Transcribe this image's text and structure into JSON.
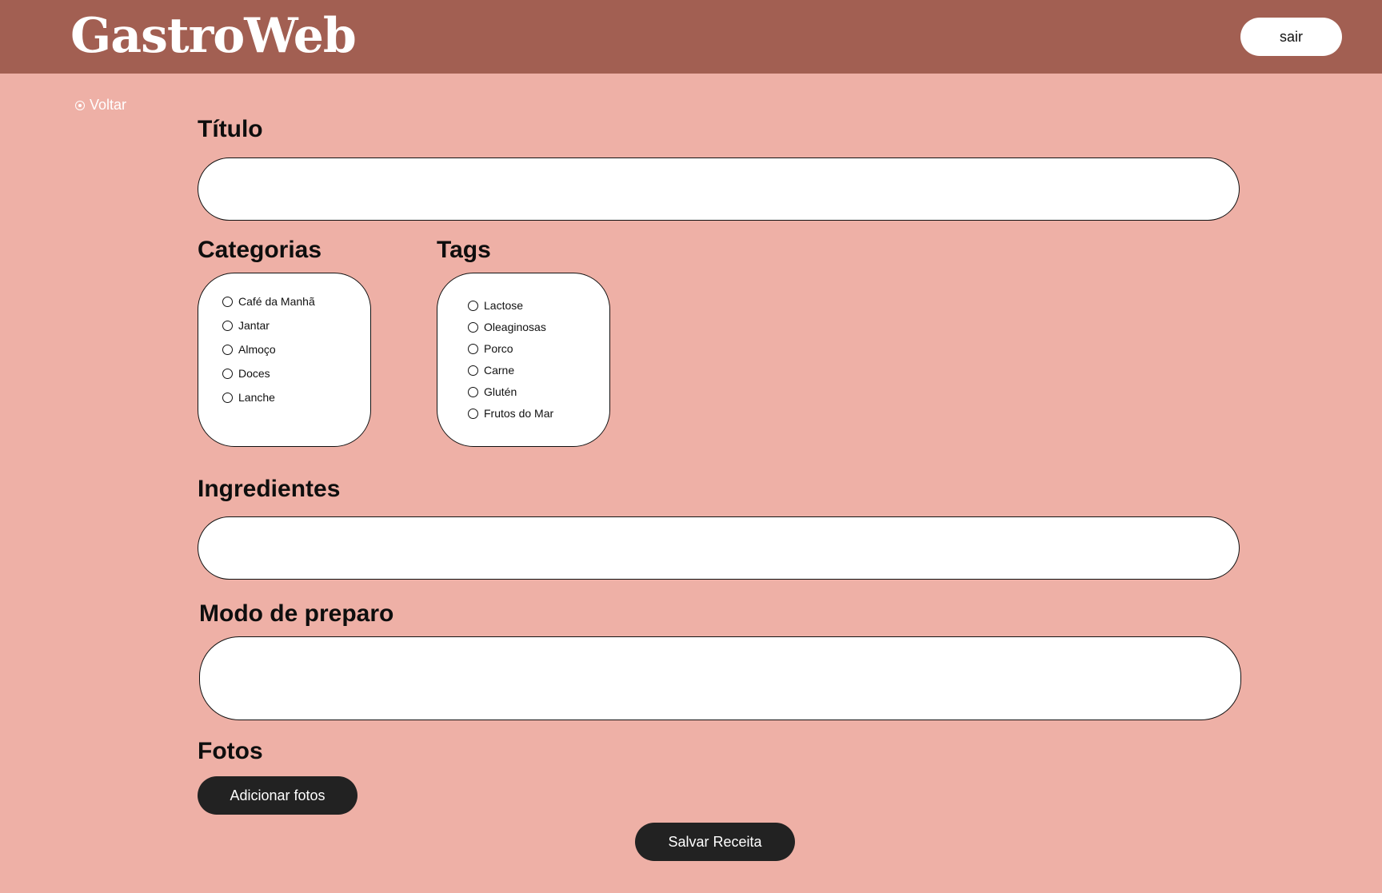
{
  "header": {
    "logo": "GastroWeb",
    "logout_label": "sair"
  },
  "nav": {
    "back_label": "Voltar"
  },
  "form": {
    "title_label": "Título",
    "title_value": "",
    "categories_label": "Categorias",
    "categories": [
      "Café da Manhã",
      "Jantar",
      "Almoço",
      "Doces",
      "Lanche"
    ],
    "tags_label": "Tags",
    "tags": [
      "Lactose",
      "Oleaginosas",
      "Porco",
      "Carne",
      "Glutén",
      "Frutos do Mar"
    ],
    "ingredients_label": "Ingredientes",
    "ingredients_value": "",
    "method_label": "Modo de preparo",
    "method_value": "",
    "photos_label": "Fotos",
    "add_photos_label": "Adicionar fotos",
    "save_label": "Salvar Receita"
  },
  "colors": {
    "header_bg": "#A25F52",
    "page_bg": "#EEB0A6",
    "button_dark": "#222222"
  }
}
